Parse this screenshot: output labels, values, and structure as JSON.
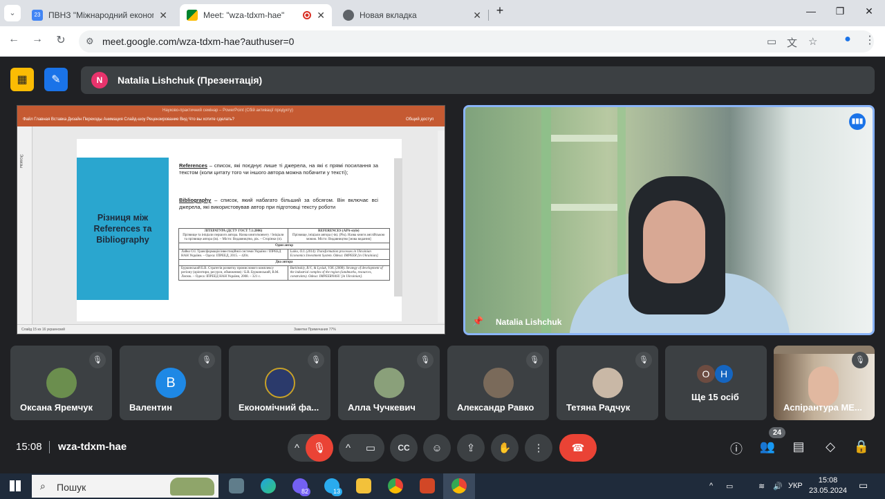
{
  "browser": {
    "tabs": [
      {
        "title": "ПВНЗ \"Міжнародний економі",
        "favicon_color": "#4285f4"
      },
      {
        "title": "Meet: \"wza-tdxm-hae\"",
        "favicon_color": "#00832d"
      },
      {
        "title": "Новая вкладка",
        "favicon_color": "#5f6368"
      }
    ],
    "url": "meet.google.com/wza-tdxm-hae?authuser=0"
  },
  "meet": {
    "presenter_label": "Natalia Lishchuk (Презентація)",
    "presenter_initial": "N",
    "camera_name": "Natalia Lishchuk",
    "time": "15:08",
    "meeting_code": "wza-tdxm-hae",
    "participant_count": "24",
    "participants": [
      {
        "name": "Оксана Яремчук",
        "initial": "",
        "color": "#6b8e4e"
      },
      {
        "name": "Валентин",
        "initial": "В",
        "color": "#1e88e5"
      },
      {
        "name": "Економічний фа...",
        "initial": "",
        "color": "#2b3a6b"
      },
      {
        "name": "Алла Чучкевич",
        "initial": "",
        "color": "#8aa07a"
      },
      {
        "name": "Александр Равко",
        "initial": "",
        "color": "#7a6a5a"
      },
      {
        "name": "Тетяна Радчук",
        "initial": "",
        "color": "#c9b8a6"
      }
    ],
    "more": {
      "label": "Ще 15 осіб",
      "initials": [
        "О",
        "Н"
      ],
      "colors": [
        "#6d4c41",
        "#1565c0"
      ]
    },
    "last_tile": "Аспірантура МЕ..."
  },
  "slide": {
    "app_title": "Науково-практичний семінар – PowerPoint (Сбій активації продукту)",
    "menu": "Файл   Главная   Вставка   Дизайн   Переходы   Анимация   Слайд-шоу   Рецензирование   Вид   Что вы хотите сделать?",
    "share": "Общий доступ",
    "thumbs_label": "Эскизы",
    "title": "Різниця між\nReferences та\nBibliography",
    "p1_term": "References",
    "p1_text": " – список, які поєднує лише ті джерела, на які є прямі посилання за текстом (коли цитату того чи іншого автора можна побачити у тексті);",
    "p2_term": "Bibliography",
    "p2_text": " – список, який набагато більший за обсягом. Він включає всі джерела, які використовував автор при підготовці тексту роботи",
    "table": {
      "h1": "ЛІТЕРАТУРА (ДСТУ ГОСТ 7.1:2006)",
      "h1b": "Прізвище та ініціали першого автора. Назва книги/ковчегу / Ініціали та прізвище автора (ів). – Місто: Видавництво, рік. – Сторінки (п).",
      "h2": "REFERENCES (APA-style)",
      "h2b": "Прізвище, ініціали автора (-ів). (Рік). Назва книги англійською мовою. Місто: Видавництво [мова видання]",
      "sep1": "Один автор",
      "r1a": "Лайко О.І. Трансформація інвестиційної системи України / ІПРЕЕД НАН України. – Одеса: ІПРЕЕД, 2015. – 420с.",
      "r1b": "Laiko, O.I. (2014). Transformation processes in Ukrainian Economics Investment System. Odesa: IMPEER [in Ukrainian].",
      "sep2": "Два автора",
      "r2a": "Буркинський Б.В. Стратегія розвитку промислового комплексу регіону (орієнтири, ресурси, обмеження) / Б.В. Буркинський, В.М. Лисюк. – Одеса: ІПРЕЕД НАН України, 2008. – 321 с.",
      "r2b": "Burkinskiy, B.V., & Lysiuk, V.M. (2008). Strategy of development of the industrial complex of the region (landmarks, resources, constraints). Odesa: IMPEERNASU [in Ukrainian]."
    },
    "status_left": "Слайд 15 из 16   украинский",
    "status_right": "Заметки   Примечания   77%"
  },
  "taskbar": {
    "search_label": "Пошук",
    "lang": "УКР",
    "time": "15:08",
    "date": "23.05.2024",
    "viber_badge": "82",
    "telegram_badge": "13"
  }
}
